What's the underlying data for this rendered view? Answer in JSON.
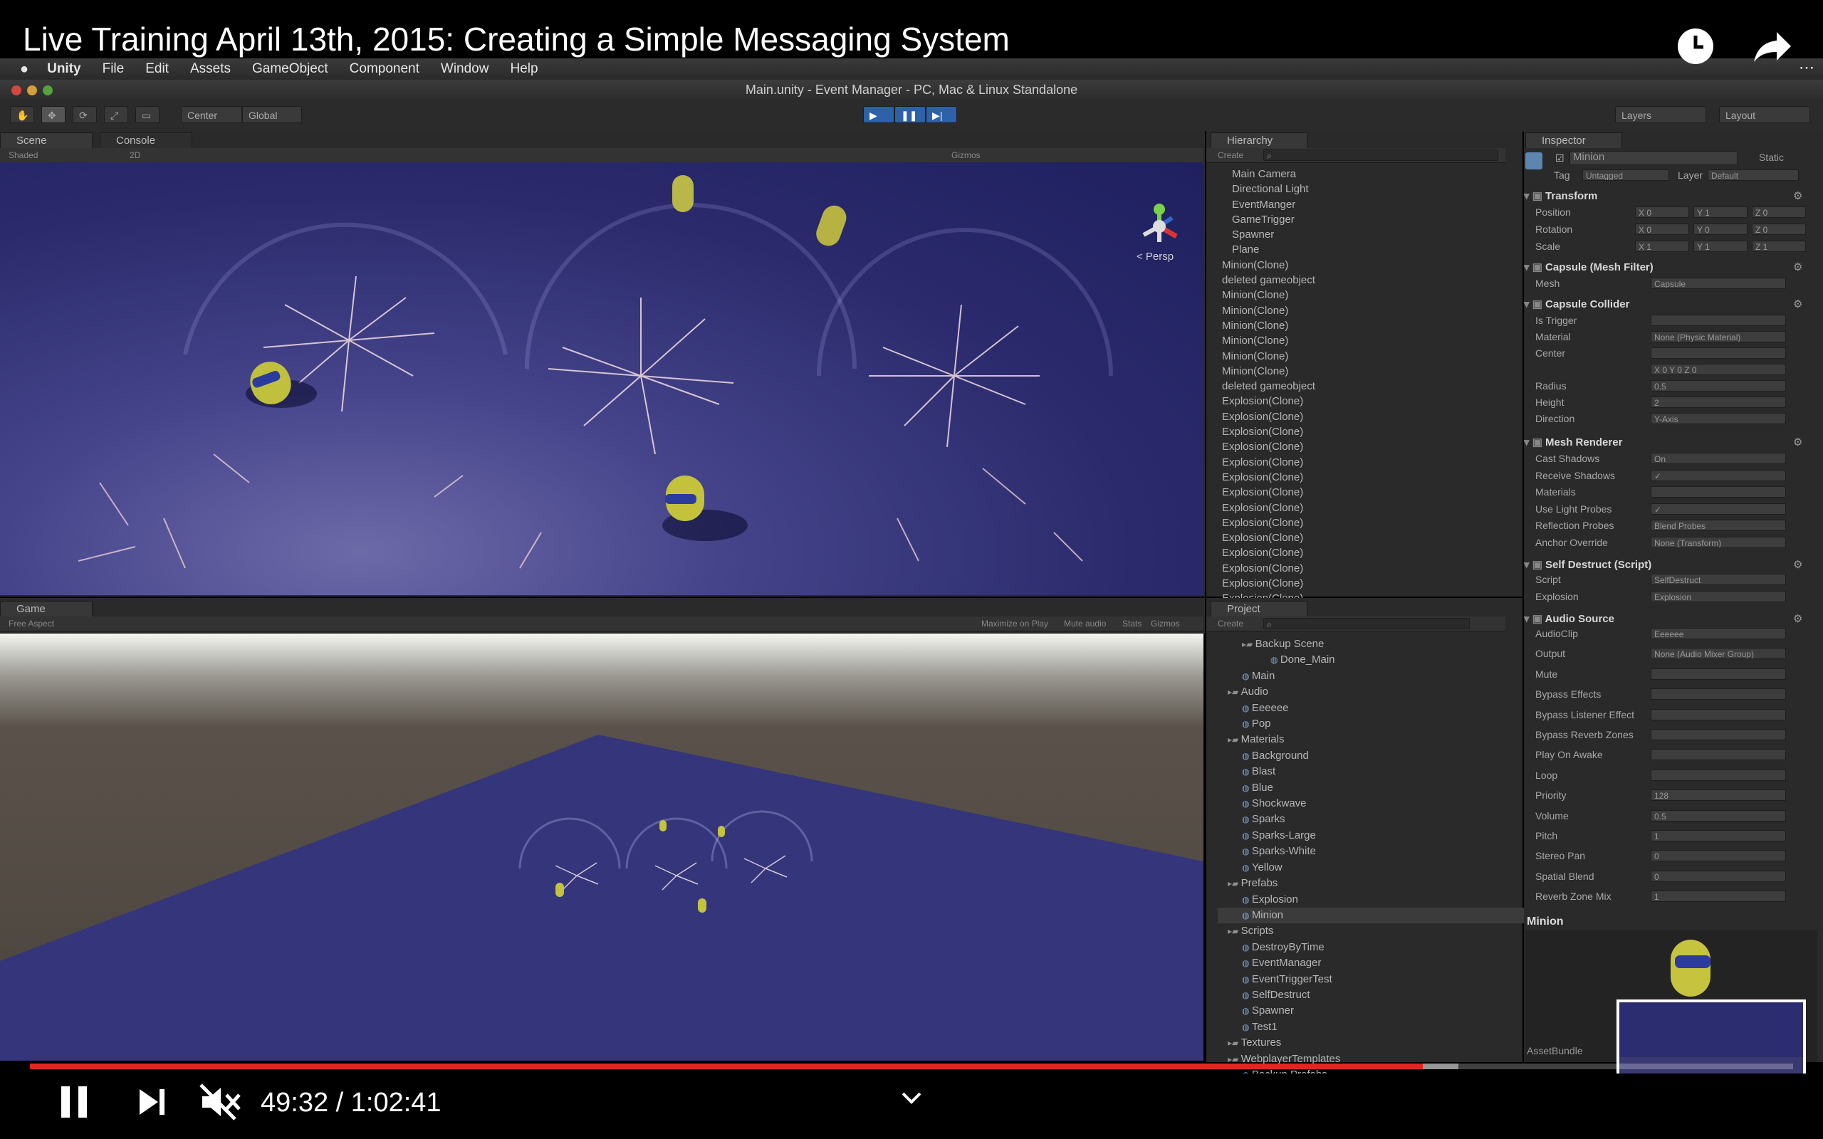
{
  "video": {
    "title": "Live Training April 13th, 2015: Creating a Simple Messaging System",
    "current_time": "49:32",
    "duration": "1:02:41",
    "time_display": "49:32 / 1:02:41",
    "progress_fraction": 0.79,
    "buffered_fraction": 0.81,
    "accent": "#e52420"
  },
  "icons": {
    "watch_later": "clock-icon",
    "share": "share-arrow-icon",
    "pause": "pause-icon",
    "next": "next-icon",
    "mute": "volume-muted-icon",
    "expand": "chevron-down-icon"
  },
  "mac_menu": [
    "Unity",
    "File",
    "Edit",
    "Assets",
    "GameObject",
    "Component",
    "Window",
    "Help"
  ],
  "window_title": "Main.unity - Event Manager - PC, Mac & Linux Standalone",
  "toolbar": {
    "pivot": "Center",
    "space": "Global",
    "layers": "Layers",
    "layout": "Layout"
  },
  "scene": {
    "tab_scene": "Scene",
    "tab_console": "Console",
    "shading": "Shaded",
    "mode2d": "2D",
    "gizmos": "Gizmos",
    "persp": "< Persp"
  },
  "game": {
    "tab": "Game",
    "aspect": "Free Aspect",
    "options": [
      "Maximize on Play",
      "Mute audio",
      "Stats",
      "Gizmos"
    ]
  },
  "hierarchy": {
    "tab": "Hierarchy",
    "create": "Create",
    "items": [
      "Main Camera",
      "Directional Light",
      "EventManger",
      "GameTrigger",
      "Spawner",
      "Plane",
      "Minion(Clone)",
      "deleted gameobject",
      "Minion(Clone)",
      "Minion(Clone)",
      "Minion(Clone)",
      "Minion(Clone)",
      "Minion(Clone)",
      "Minion(Clone)",
      "deleted gameobject",
      "Explosion(Clone)",
      "Explosion(Clone)",
      "Explosion(Clone)",
      "Explosion(Clone)",
      "Explosion(Clone)",
      "Explosion(Clone)",
      "Explosion(Clone)",
      "Explosion(Clone)",
      "Explosion(Clone)",
      "Explosion(Clone)",
      "Explosion(Clone)",
      "Explosion(Clone)",
      "Explosion(Clone)",
      "Explosion(Clone)"
    ]
  },
  "project": {
    "tab": "Project",
    "create": "Create",
    "items": [
      "Backup Scene",
      "Done_Main",
      "Main",
      "Audio",
      "Eeeeee",
      "Pop",
      "Materials",
      "Background",
      "Blast",
      "Blue",
      "Shockwave",
      "Sparks",
      "Sparks-Large",
      "Sparks-White",
      "Yellow",
      "Prefabs",
      "Explosion",
      "Minion",
      "Scripts",
      "DestroyByTime",
      "EventManager",
      "EventTriggerTest",
      "SelfDestruct",
      "Spawner",
      "Test1",
      "Textures",
      "WebplayerTemplates",
      "Backup Prefabs"
    ]
  },
  "inspector": {
    "tab": "Inspector",
    "object_name": "Minion",
    "static": "Static",
    "tag_label": "Tag",
    "tag_value": "Untagged",
    "layer_label": "Layer",
    "layer_value": "Default",
    "transform": {
      "title": "Transform",
      "position": [
        "X 0",
        "Y 1",
        "Z 0"
      ],
      "rotation": [
        "X 0",
        "Y 0",
        "Z 0"
      ],
      "scale": [
        "X 1",
        "Y 1",
        "Z 1"
      ],
      "labels": [
        "Position",
        "Rotation",
        "Scale"
      ]
    },
    "mesh_filter": {
      "title": "Capsule (Mesh Filter)",
      "label": "Mesh",
      "value": "Capsule"
    },
    "collider": {
      "title": "Capsule Collider",
      "rows": [
        {
          "label": "Is Trigger",
          "value": ""
        },
        {
          "label": "Material",
          "value": "None (Physic Material)"
        },
        {
          "label": "Center",
          "value": ""
        },
        {
          "label": "",
          "value": "X 0     Y 0     Z 0"
        },
        {
          "label": "Radius",
          "value": "0.5"
        },
        {
          "label": "Height",
          "value": "2"
        },
        {
          "label": "Direction",
          "value": "Y-Axis"
        }
      ]
    },
    "renderer": {
      "title": "Mesh Renderer",
      "rows": [
        {
          "label": "Cast Shadows",
          "value": "On"
        },
        {
          "label": "Receive Shadows",
          "value": "✓"
        },
        {
          "label": "Materials",
          "value": ""
        },
        {
          "label": "Use Light Probes",
          "value": "✓"
        },
        {
          "label": "Reflection Probes",
          "value": "Blend Probes"
        },
        {
          "label": "Anchor Override",
          "value": "None (Transform)"
        }
      ]
    },
    "self_destruct": {
      "title": "Self Destruct (Script)",
      "rows": [
        {
          "label": "Script",
          "value": "SelfDestruct"
        },
        {
          "label": "Explosion",
          "value": "Explosion"
        }
      ]
    },
    "audio": {
      "title": "Audio Source",
      "rows": [
        {
          "label": "AudioClip",
          "value": "Eeeeee"
        },
        {
          "label": "Output",
          "value": "None (Audio Mixer Group)"
        },
        {
          "label": "Mute",
          "value": ""
        },
        {
          "label": "Bypass Effects",
          "value": ""
        },
        {
          "label": "Bypass Listener Effect",
          "value": ""
        },
        {
          "label": "Bypass Reverb Zones",
          "value": ""
        },
        {
          "label": "Play On Awake",
          "value": ""
        },
        {
          "label": "Loop",
          "value": ""
        },
        {
          "label": "Priority",
          "value": "128"
        },
        {
          "label": "Volume",
          "value": "0.5"
        },
        {
          "label": "Pitch",
          "value": "1"
        },
        {
          "label": "Stereo Pan",
          "value": "0"
        },
        {
          "label": "Spatial Blend",
          "value": "0"
        },
        {
          "label": "Reverb Zone Mix",
          "value": "1"
        }
      ]
    },
    "preview_title": "Minion",
    "asset_bundle": "AssetBundle"
  }
}
